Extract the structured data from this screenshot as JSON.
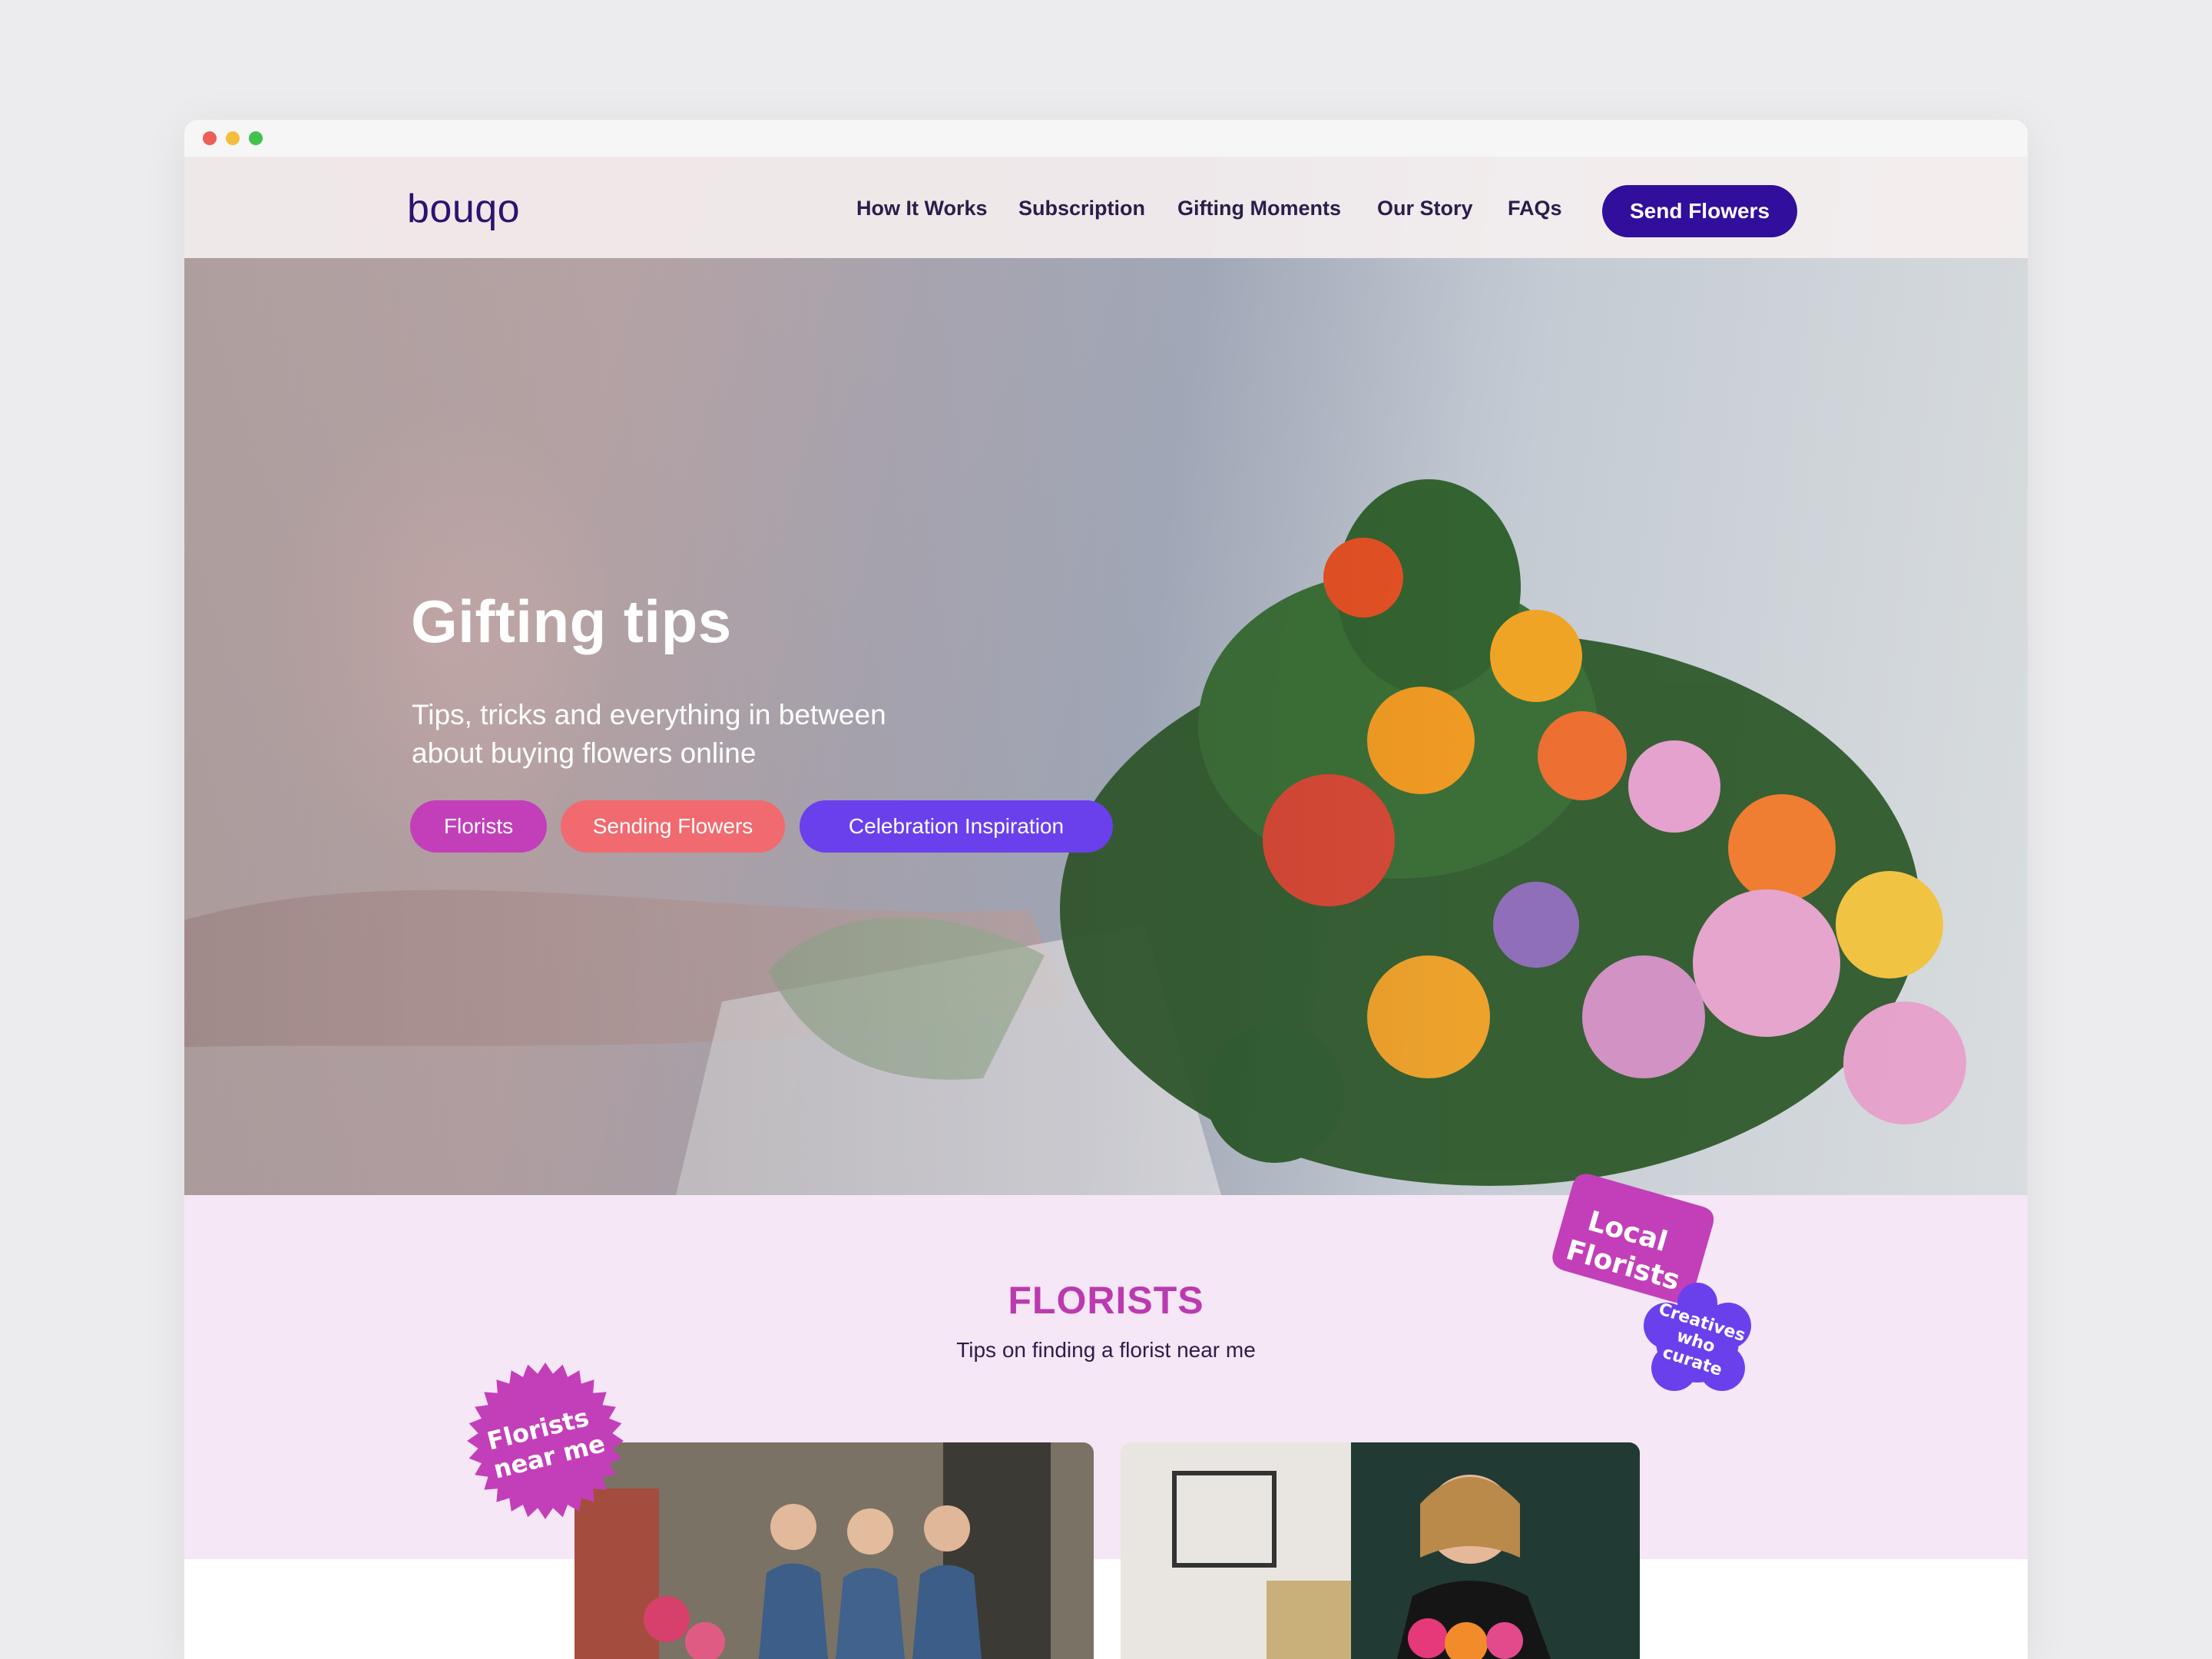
{
  "nav": {
    "logo": "bouqo",
    "links": [
      "How It Works",
      "Subscription",
      "Gifting Moments",
      "Our Story",
      "FAQs"
    ],
    "cta": "Send Flowers"
  },
  "hero": {
    "title": "Gifting tips",
    "subtitle_line1": "Tips, tricks and everything in between",
    "subtitle_line2": "about buying flowers online",
    "tags": [
      "Florists",
      "Sending Flowers",
      "Celebration Inspiration"
    ]
  },
  "section": {
    "title": "FLORISTS",
    "subtitle": "Tips on finding a florist near me"
  },
  "stickers": {
    "local_florists": [
      "Local",
      "Florists"
    ],
    "creatives": [
      "Creatives",
      "who",
      "curate"
    ],
    "near_me": [
      "Florists",
      "near me"
    ]
  },
  "colors": {
    "brand": "#310e9c",
    "florists_tag": "#c33fb9",
    "sending_tag": "#f06a6f",
    "celebration_tag": "#6a40ec",
    "section_bg": "#f5e7f6",
    "section_title": "#bb3aaf"
  }
}
